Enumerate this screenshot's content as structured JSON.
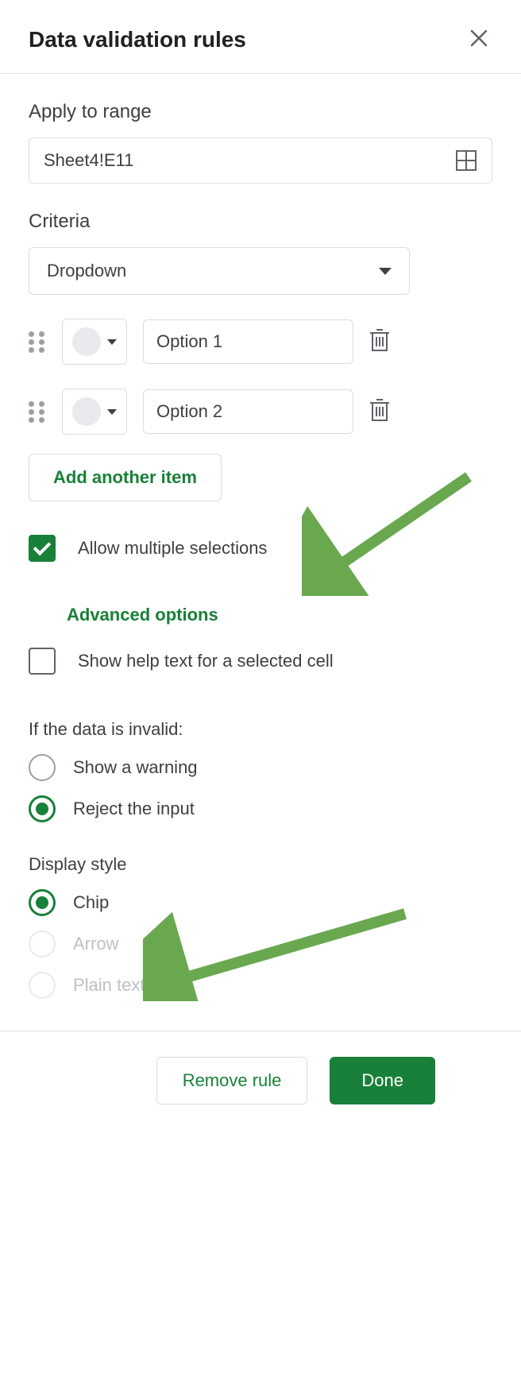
{
  "header": {
    "title": "Data validation rules"
  },
  "apply": {
    "label": "Apply to range",
    "value": "Sheet4!E11"
  },
  "criteria": {
    "label": "Criteria",
    "selected": "Dropdown"
  },
  "options": [
    {
      "value": "Option 1"
    },
    {
      "value": "Option 2"
    }
  ],
  "add_item": "Add another item",
  "allow_multi": {
    "label": "Allow multiple selections",
    "checked": true
  },
  "advanced": {
    "label": "Advanced options"
  },
  "help_text": {
    "label": "Show help text for a selected cell",
    "checked": false
  },
  "invalid": {
    "heading": "If the data is invalid:",
    "warning": "Show a warning",
    "reject": "Reject the input",
    "selected": "reject"
  },
  "display": {
    "heading": "Display style",
    "chip": "Chip",
    "arrow": "Arrow",
    "plain": "Plain text",
    "selected": "chip"
  },
  "footer": {
    "remove": "Remove rule",
    "done": "Done"
  }
}
